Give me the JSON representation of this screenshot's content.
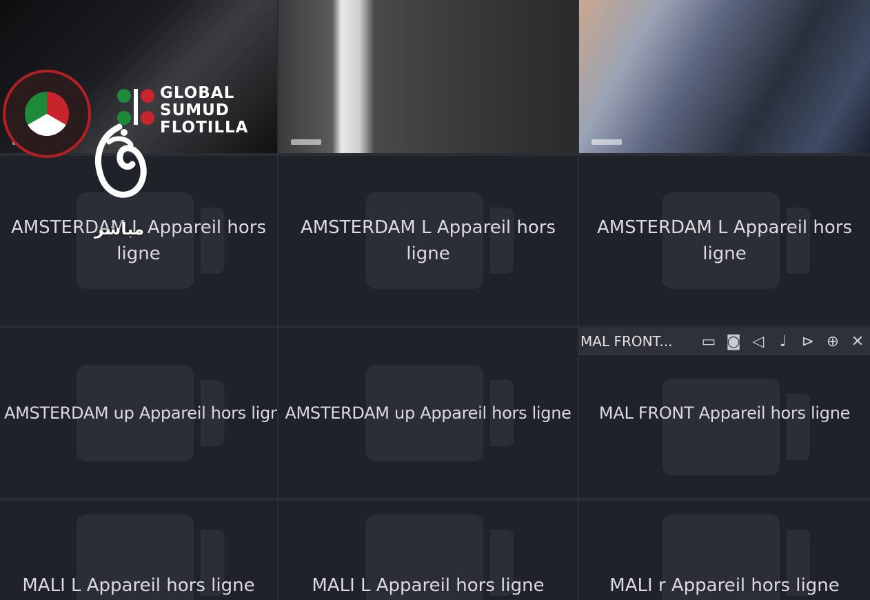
{
  "feeds": [
    {
      "id": "feed-1"
    },
    {
      "id": "feed-2"
    },
    {
      "id": "feed-3"
    }
  ],
  "logos": {
    "flotilla_lines": [
      "GLOBAL",
      "SUMUD",
      "FLOTILLA"
    ],
    "channel_sub": "مباشر"
  },
  "offline_tiles": [
    {
      "label": "AMSTERDAM L Appareil hors ligne"
    },
    {
      "label": "AMSTERDAM L Appareil hors ligne"
    },
    {
      "label": "AMSTERDAM L Appareil hors ligne"
    },
    {
      "label": "AMSTERDAM up Appareil hors ligne"
    },
    {
      "label": "AMSTERDAM up Appareil hors ligne"
    },
    {
      "label": "MAL FRONT Appareil hors ligne"
    },
    {
      "label": "MALI L Appareil hors ligne"
    },
    {
      "label": "MALI L Appareil hors ligne"
    },
    {
      "label": "MALI r Appareil hors ligne"
    }
  ],
  "selected_tile_toolbar": {
    "title": "MAL FRONT...",
    "icons": [
      "screen-icon",
      "camera-icon",
      "speaker-icon",
      "microphone-icon",
      "play-icon",
      "zoom-in-icon",
      "close-icon"
    ]
  },
  "colors": {
    "background": "#2a2d33",
    "tile": "#1f2228",
    "label": "#d9dbe0",
    "logo_red": "#b41e25"
  }
}
